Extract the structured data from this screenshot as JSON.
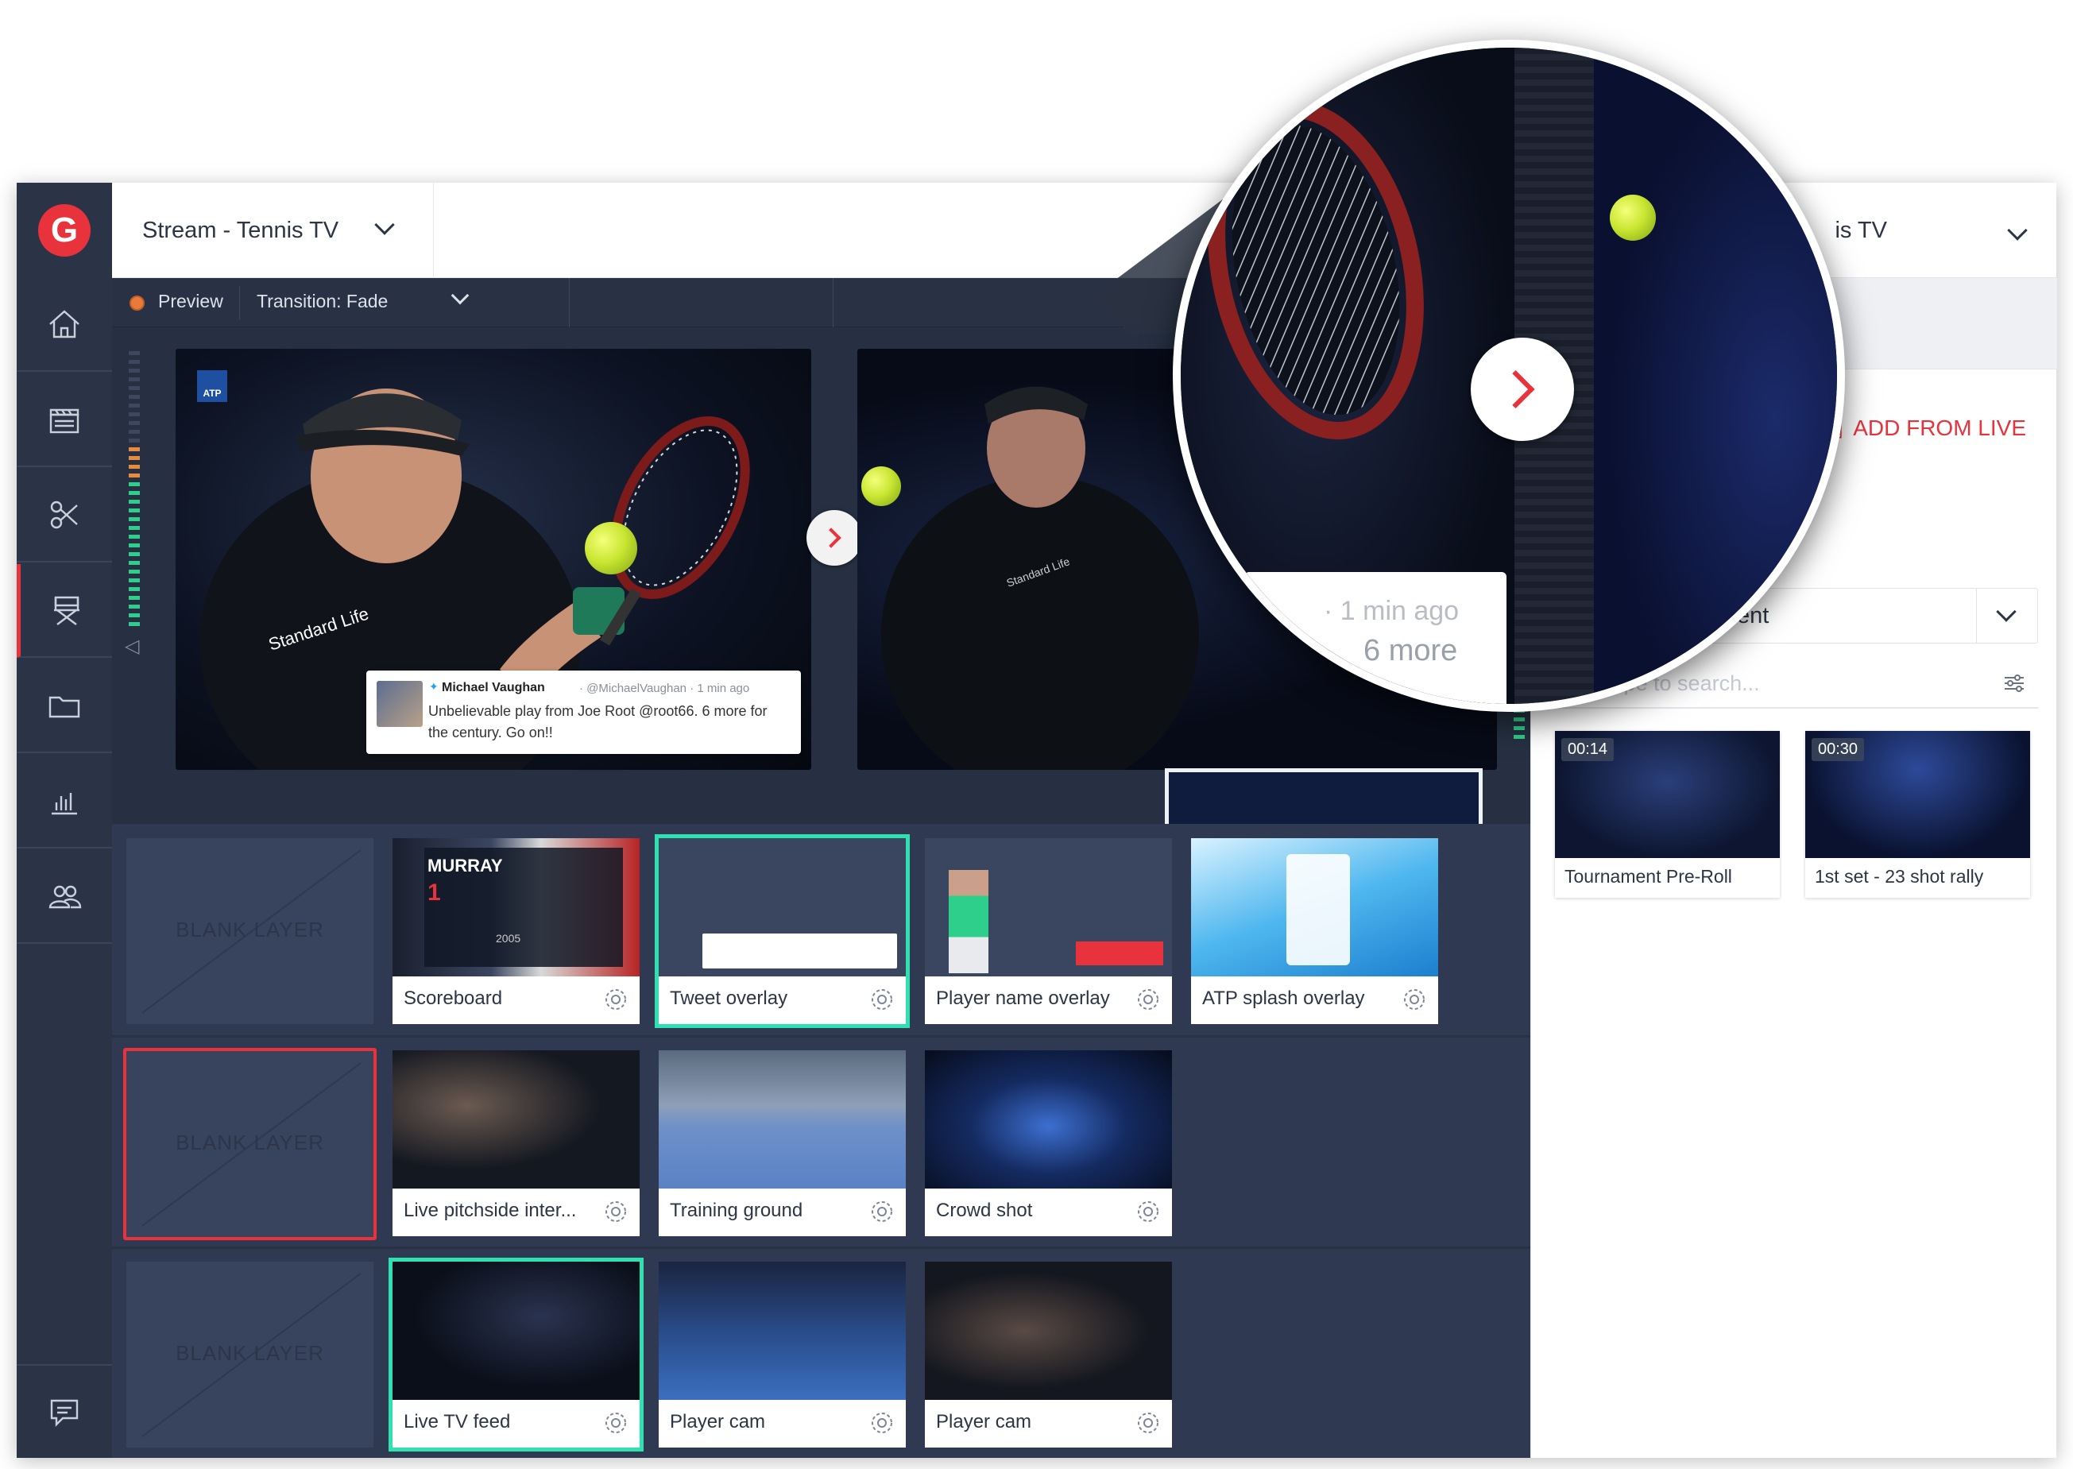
{
  "app": {
    "logo_letter": "G",
    "stream_select_label": "Stream - Tennis TV",
    "right_select_label": "is TV"
  },
  "sidebar": {
    "items": [
      {
        "name": "home-icon"
      },
      {
        "name": "clapperboard-icon"
      },
      {
        "name": "scissors-icon"
      },
      {
        "name": "director-chair-icon",
        "active": true
      },
      {
        "name": "folder-icon"
      },
      {
        "name": "bar-chart-icon"
      },
      {
        "name": "users-icon"
      }
    ],
    "bottom_icon": "chat-icon"
  },
  "preview_toolbar": {
    "preview_label": "Preview",
    "transition_label": "Transition: Fade"
  },
  "monitor": {
    "tweet": {
      "name": "Michael Vaughan",
      "meta": "· @MichaelVaughan · 1 min ago",
      "text": "Unbelievable play from Joe Root @root66. 6 more for the century. Go on!!"
    },
    "badge": "ATP"
  },
  "magnifier": {
    "line1": "· 1 min ago",
    "line2": "6 more"
  },
  "layers": {
    "blank_label": "BLANK LAYER",
    "row1": [
      {
        "label": "Scoreboard"
      },
      {
        "label": "Tweet overlay",
        "selected": true
      },
      {
        "label": "Player name overlay"
      },
      {
        "label": "ATP splash overlay"
      }
    ],
    "row2": [
      {
        "label": "Live pitchside inter..."
      },
      {
        "label": "Training ground"
      },
      {
        "label": "Crowd shot"
      }
    ],
    "row3": [
      {
        "label": "Live TV feed",
        "selected": true
      },
      {
        "label": "Player cam"
      },
      {
        "label": "Player cam"
      }
    ],
    "scoreboard_thumb": {
      "name": "MURRAY",
      "rank": "1",
      "year": "2005"
    }
  },
  "right_panel": {
    "add_from_live": "ADD FROM LIVE",
    "select_value": "ent",
    "search_placeholder": "Type to search...",
    "clips": [
      {
        "duration": "00:14",
        "label": "Tournament Pre-Roll"
      },
      {
        "duration": "00:30",
        "label": "1st set - 23 shot rally"
      }
    ]
  },
  "colors": {
    "brand_red": "#e8323c",
    "selection_teal": "#2fe0b0",
    "meter_green": "#2ecf8a",
    "meter_orange": "#e88b3c"
  }
}
